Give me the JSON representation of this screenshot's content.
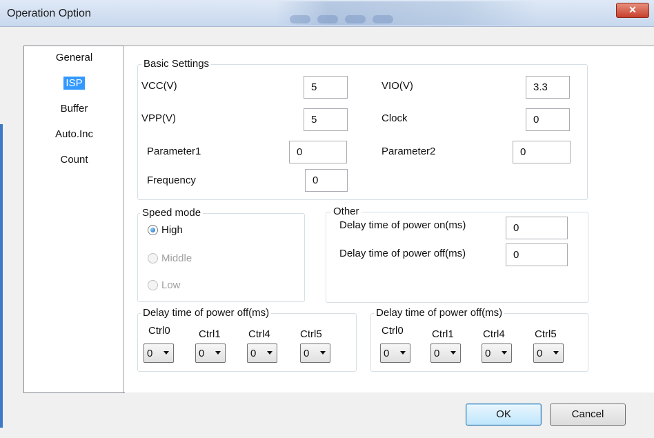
{
  "window": {
    "title": "Operation Option",
    "close_glyph": "✕"
  },
  "categories": [
    {
      "label": "General",
      "selected": false
    },
    {
      "label": "ISP",
      "selected": true
    },
    {
      "label": "Buffer",
      "selected": false
    },
    {
      "label": "Auto.Inc",
      "selected": false
    },
    {
      "label": "Count",
      "selected": false
    }
  ],
  "basic": {
    "title": "Basic Settings",
    "vcc": {
      "label": "VCC(V)",
      "value": "5"
    },
    "vio": {
      "label": "VIO(V)",
      "value": "3.3"
    },
    "vpp": {
      "label": "VPP(V)",
      "value": "5"
    },
    "clock": {
      "label": "Clock",
      "value": "0"
    },
    "param1": {
      "label": "Parameter1",
      "value": "0"
    },
    "param2": {
      "label": "Parameter2",
      "value": "0"
    },
    "frequency": {
      "label": "Frequency",
      "value": "0"
    }
  },
  "speed": {
    "title": "Speed mode",
    "high": "High",
    "middle": "Middle",
    "low": "Low",
    "selected": "High"
  },
  "other": {
    "title": "Other",
    "on_label": "Delay time of power on(ms)",
    "on_value": "0",
    "off_label": "Delay time of power off(ms)",
    "off_value": "0"
  },
  "ctrl_left": {
    "title": "Delay time of power off(ms)",
    "labels": [
      "Ctrl0",
      "Ctrl1",
      "Ctrl4",
      "Ctrl5"
    ],
    "values": [
      "0",
      "0",
      "0",
      "0"
    ]
  },
  "ctrl_right": {
    "title": "Delay time of power off(ms)",
    "labels": [
      "Ctrl0",
      "Ctrl1",
      "Ctrl4",
      "Ctrl5"
    ],
    "values": [
      "0",
      "0",
      "0",
      "0"
    ]
  },
  "buttons": {
    "ok": "OK",
    "cancel": "Cancel"
  },
  "colors": {
    "selection": "#3399ff",
    "titlebar": "#c8d8ee",
    "close": "#c7402c"
  }
}
